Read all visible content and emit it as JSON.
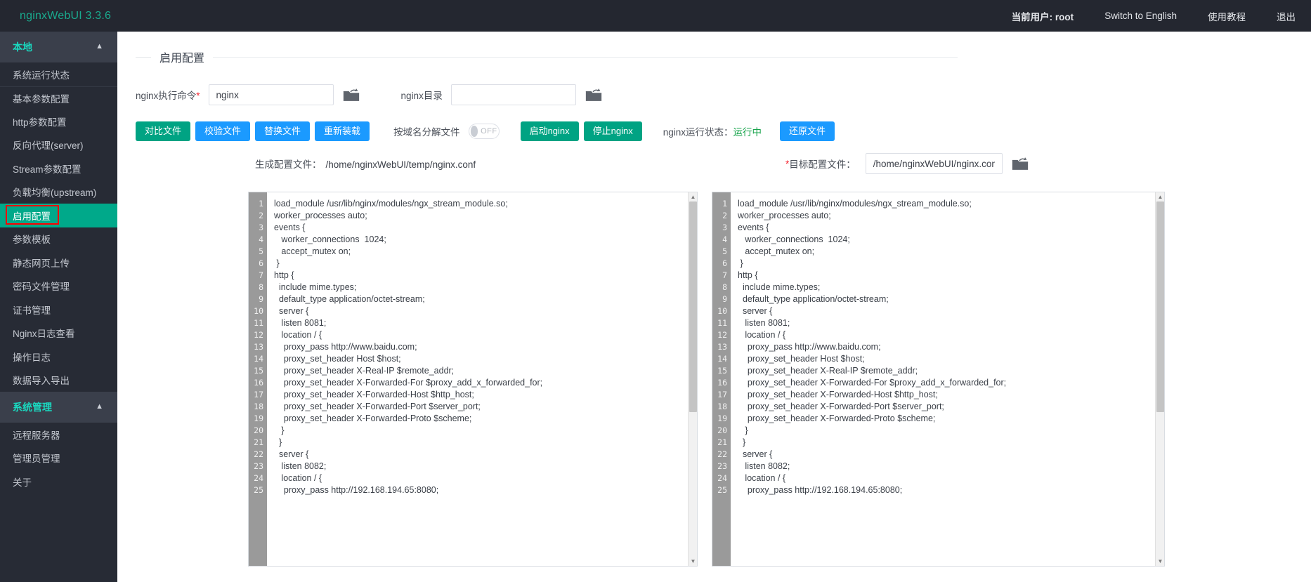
{
  "header": {
    "brand": "nginxWebUI 3.3.6",
    "links": [
      {
        "label": "当前用户: root",
        "name": "current-user"
      },
      {
        "label": "Switch to English",
        "name": "switch-language"
      },
      {
        "label": "使用教程",
        "name": "tutorial"
      },
      {
        "label": "退出",
        "name": "logout"
      }
    ]
  },
  "sidebar": {
    "groups": [
      {
        "label": "本地",
        "items": [
          {
            "label": "系统运行状态",
            "active": false,
            "sep": false
          },
          {
            "label": "基本参数配置",
            "active": false,
            "sep": true
          },
          {
            "label": "http参数配置",
            "active": false,
            "sep": false
          },
          {
            "label": "反向代理(server)",
            "active": false,
            "sep": false
          },
          {
            "label": "Stream参数配置",
            "active": false,
            "sep": false
          },
          {
            "label": "负载均衡(upstream)",
            "active": false,
            "sep": false
          },
          {
            "label": "启用配置",
            "active": true,
            "sep": false
          },
          {
            "label": "参数模板",
            "active": false,
            "sep": false
          },
          {
            "label": "静态网页上传",
            "active": false,
            "sep": false
          },
          {
            "label": "密码文件管理",
            "active": false,
            "sep": false
          },
          {
            "label": "证书管理",
            "active": false,
            "sep": false
          },
          {
            "label": "Nginx日志查看",
            "active": false,
            "sep": false
          },
          {
            "label": "操作日志",
            "active": false,
            "sep": false
          },
          {
            "label": "数据导入导出",
            "active": false,
            "sep": false
          }
        ]
      },
      {
        "label": "系统管理",
        "items": [
          {
            "label": "远程服务器",
            "active": false,
            "sep": false
          },
          {
            "label": "管理员管理",
            "active": false,
            "sep": false
          },
          {
            "label": "关于",
            "active": false,
            "sep": false
          }
        ]
      }
    ]
  },
  "page": {
    "title": "启用配置"
  },
  "form": {
    "cmd_label": "nginx执行命令",
    "cmd_required": "*",
    "cmd_value": "nginx",
    "cmd_placeholder": "",
    "dir_label": "nginx目录",
    "dir_value": "",
    "dir_placeholder": ""
  },
  "toolbar": {
    "compare_label": "对比文件",
    "check_label": "校验文件",
    "replace_label": "替换文件",
    "reload_label": "重新装载",
    "split_label": "按域名分解文件",
    "toggle_state": "OFF",
    "start_label": "启动nginx",
    "stop_label": "停止nginx",
    "status_label": "nginx运行状态：",
    "status_value": "运行中",
    "restore_label": "还原文件"
  },
  "paths": {
    "generated_label": "生成配置文件：",
    "generated_value": "/home/nginxWebUI/temp/nginx.conf",
    "target_required": "*",
    "target_label": "目标配置文件：",
    "target_value": "/home/nginxWebUI/nginx.conf"
  },
  "colors": {
    "brand_teal": "#1aaa8e",
    "accent_green": "#00a383",
    "accent_blue": "#1b9aff",
    "sidebar_bg": "#272b35",
    "topbar_bg": "#242730",
    "active_item": "#00a98a",
    "highlight_border": "#ff0000",
    "status_running": "#16a34a"
  },
  "editor_left": {
    "lines": [
      "load_module /usr/lib/nginx/modules/ngx_stream_module.so;",
      "worker_processes auto;",
      "events {",
      "   worker_connections  1024;",
      "   accept_mutex on;",
      " }",
      "http {",
      "  include mime.types;",
      "  default_type application/octet-stream;",
      "  server {",
      "   listen 8081;",
      "   location / {",
      "    proxy_pass http://www.baidu.com;",
      "    proxy_set_header Host $host;",
      "    proxy_set_header X-Real-IP $remote_addr;",
      "    proxy_set_header X-Forwarded-For $proxy_add_x_forwarded_for;",
      "    proxy_set_header X-Forwarded-Host $http_host;",
      "    proxy_set_header X-Forwarded-Port $server_port;",
      "    proxy_set_header X-Forwarded-Proto $scheme;",
      "   }",
      "  }",
      "  server {",
      "   listen 8082;",
      "   location / {",
      "    proxy_pass http://192.168.194.65:8080;"
    ]
  },
  "editor_right": {
    "lines": [
      "load_module /usr/lib/nginx/modules/ngx_stream_module.so;",
      "worker_processes auto;",
      "events {",
      "   worker_connections  1024;",
      "   accept_mutex on;",
      " }",
      "http {",
      "  include mime.types;",
      "  default_type application/octet-stream;",
      "  server {",
      "   listen 8081;",
      "   location / {",
      "    proxy_pass http://www.baidu.com;",
      "    proxy_set_header Host $host;",
      "    proxy_set_header X-Real-IP $remote_addr;",
      "    proxy_set_header X-Forwarded-For $proxy_add_x_forwarded_for;",
      "    proxy_set_header X-Forwarded-Host $http_host;",
      "    proxy_set_header X-Forwarded-Port $server_port;",
      "    proxy_set_header X-Forwarded-Proto $scheme;",
      "   }",
      "  }",
      "  server {",
      "   listen 8082;",
      "   location / {",
      "    proxy_pass http://192.168.194.65:8080;"
    ]
  }
}
